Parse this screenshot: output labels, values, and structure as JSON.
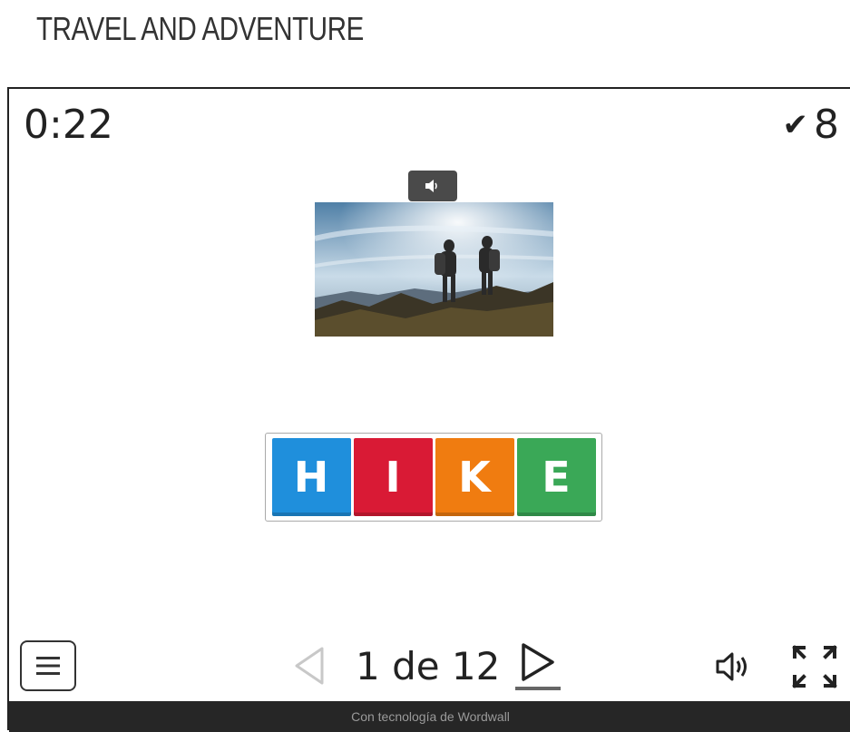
{
  "page": {
    "title": "TRAVEL AND ADVENTURE"
  },
  "game": {
    "timer": "0:22",
    "score": "8",
    "score_icon": "checkmark-icon",
    "audio_chip_icon": "speaker-icon",
    "image_icon": "hikers-photo",
    "word_tiles": [
      {
        "letter": "H",
        "color": "#1f8fdc"
      },
      {
        "letter": "I",
        "color": "#d91a35"
      },
      {
        "letter": "K",
        "color": "#f07c10"
      },
      {
        "letter": "E",
        "color": "#3aa857"
      }
    ]
  },
  "controls": {
    "menu_icon": "menu-icon",
    "prev_icon": "previous-icon",
    "next_icon": "next-icon",
    "pagination": "1 de 12",
    "sound_icon": "sound-icon",
    "fullscreen_icon": "fullscreen-icon"
  },
  "footer": {
    "text": "Con tecnología de Wordwall"
  }
}
